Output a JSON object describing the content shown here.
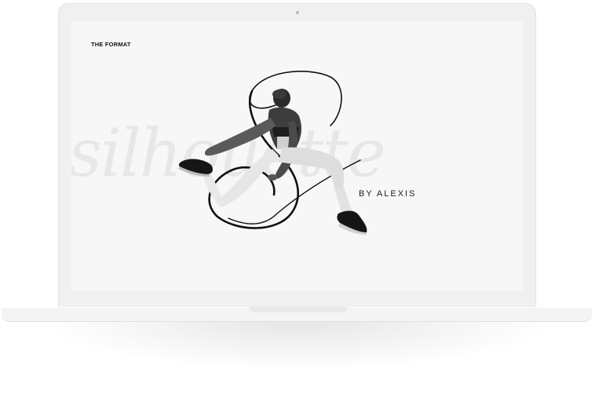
{
  "site": {
    "brand": "THE FORMAT",
    "background_word": "silhouette",
    "monogram": "S",
    "byline": "BY ALEXIS"
  },
  "colors": {
    "screen_background": "#f7f7f7",
    "script_watermark": "#e6e6e6",
    "text": "#111111",
    "laptop_body": "#f0f0f0"
  },
  "icons": {
    "camera": "camera-dot-icon"
  }
}
